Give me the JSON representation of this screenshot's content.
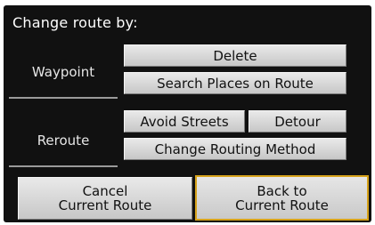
{
  "title": "Change route by:",
  "sections": {
    "waypoint": {
      "label": "Waypoint"
    },
    "reroute": {
      "label": "Reroute"
    }
  },
  "buttons": {
    "delete": "Delete",
    "search_places": "Search Places on Route",
    "avoid_streets": "Avoid Streets",
    "detour": "Detour",
    "change_routing": "Change Routing Method",
    "cancel_line1": "Cancel",
    "cancel_line2": "Current Route",
    "back_line1": "Back to",
    "back_line2": "Current Route"
  },
  "colors": {
    "screen_background": "#111111",
    "button_face": "#d8d8d8",
    "selection_highlight": "#d6a21a"
  }
}
